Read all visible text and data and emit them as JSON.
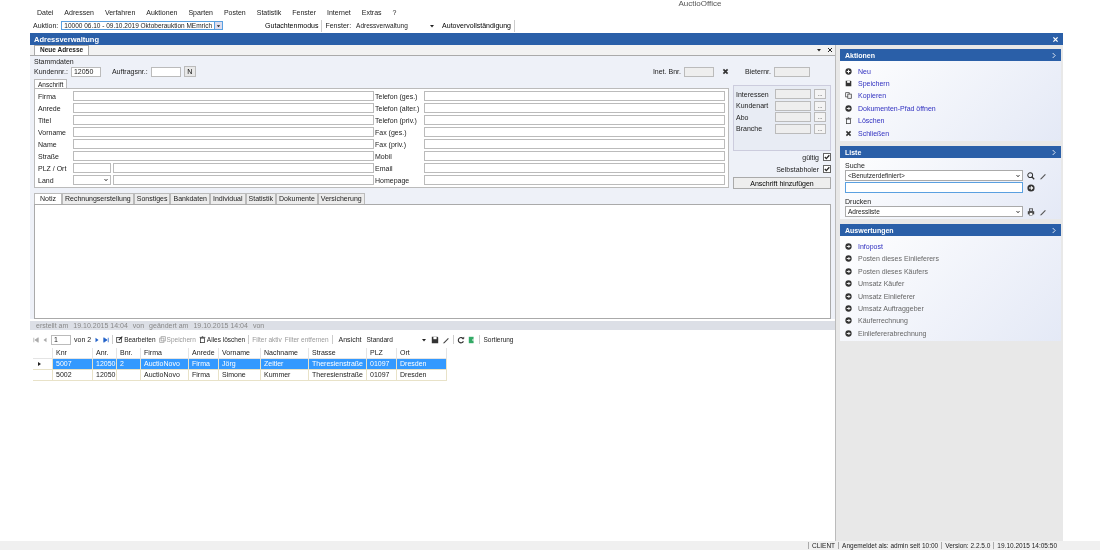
{
  "window": {
    "title": "AuctioOffice"
  },
  "menu": [
    "Datei",
    "Adressen",
    "Verfahren",
    "Auktionen",
    "Sparten",
    "Posten",
    "Statistik",
    "Fenster",
    "Internet",
    "Extras",
    "?"
  ],
  "toolbar": {
    "auction_label": "Auktion:",
    "auction_value": "10000 06.10 - 09.10.2019 Oktoberauktion MEmrich",
    "expert_mode": "Gutachtenmodus",
    "window_label": "Fenster:",
    "window_value": "Adressverwaltung",
    "autocomplete": "Autovervollständigung"
  },
  "panel": {
    "title": "Adressverwaltung"
  },
  "doc_tabs": [
    {
      "label": "Neue Adresse",
      "selected": true
    }
  ],
  "master": {
    "section": "Stammdaten",
    "customer_label": "Kundennr.:",
    "customer_value": "12050",
    "order_label": "Auftragsnr.:",
    "order_button": "N",
    "inet_label": "Inet. Bnr.",
    "bidder_label": "Bieternr."
  },
  "address_tab": "Anschrift",
  "left_fields": [
    {
      "label": "Firma",
      "kind": "text"
    },
    {
      "label": "Anrede",
      "kind": "text"
    },
    {
      "label": "Titel",
      "kind": "text"
    },
    {
      "label": "Vorname",
      "kind": "text"
    },
    {
      "label": "Name",
      "kind": "text"
    },
    {
      "label": "Straße",
      "kind": "text"
    },
    {
      "label": "PLZ / Ort",
      "kind": "split"
    },
    {
      "label": "Land",
      "kind": "select"
    }
  ],
  "right_fields": [
    "Telefon (ges.)",
    "Telefon (alter.)",
    "Telefon (priv.)",
    "Fax (ges.)",
    "Fax (priv.)",
    "Mobil",
    "Email",
    "Homepage"
  ],
  "lookups": [
    {
      "label": "Interessen",
      "button": "..."
    },
    {
      "label": "Kundenart",
      "button": "..."
    },
    {
      "label": "Abo",
      "button": "..."
    },
    {
      "label": "Branche",
      "button": "..."
    }
  ],
  "checks": [
    {
      "label": "gültig",
      "checked": true
    },
    {
      "label": "Selbstabholer",
      "checked": true
    }
  ],
  "add_address_button": "Anschrift hinzufügen",
  "detail_tabs": [
    {
      "label": "Notiz",
      "selected": true
    },
    {
      "label": "Rechnungserstellung",
      "selected": false
    },
    {
      "label": "Sonstiges",
      "selected": false
    },
    {
      "label": "Bankdaten",
      "selected": false
    },
    {
      "label": "Individual",
      "selected": false
    },
    {
      "label": "Statistik",
      "selected": false
    },
    {
      "label": "Dokumente",
      "selected": false
    },
    {
      "label": "Versicherung",
      "selected": false
    }
  ],
  "audit": [
    "erstellt am",
    "19.10.2015 14:04",
    "von",
    "geändert am",
    "19.10.2015 14:04",
    "von"
  ],
  "grid_toolbar": {
    "page": "1",
    "page_of": "von 2",
    "items": [
      {
        "kind": "edit",
        "label": "Bearbeiten",
        "disabled": false
      },
      {
        "kind": "save",
        "label": "Speichern",
        "disabled": true
      },
      {
        "kind": "delete",
        "label": "Alles löschen",
        "disabled": false
      },
      {
        "kind": "filter",
        "label": "Filter aktiv",
        "disabled": true
      },
      {
        "kind": "filter",
        "label": "Filter entfernen",
        "disabled": true
      }
    ],
    "view_label": "Ansicht",
    "view_value": "Standard",
    "sorting": "Sortierung"
  },
  "table": {
    "columns": [
      "Knr",
      "Anr.",
      "Bnr.",
      "Firma",
      "Anrede",
      "Vorname",
      "Nachname",
      "Strasse",
      "PLZ",
      "Ort"
    ],
    "rows": [
      {
        "selected": true,
        "cells": [
          "5007",
          "12050",
          "2",
          "AuctioNovo",
          "Firma",
          "Jörg",
          "Zeitler",
          "Theresienstraße",
          "01097",
          "Dresden"
        ]
      },
      {
        "selected": false,
        "cells": [
          "5002",
          "12050",
          "",
          "AuctioNovo",
          "Firma",
          "Simone",
          "Kummer",
          "Theresienstraße",
          "01097",
          "Dresden"
        ]
      }
    ]
  },
  "actions": {
    "title": "Aktionen",
    "items": [
      {
        "kind": "new",
        "label": "Neu"
      },
      {
        "kind": "save",
        "label": "Speichern"
      },
      {
        "kind": "copy",
        "label": "Kopieren"
      },
      {
        "kind": "open",
        "label": "Dokumenten-Pfad öffnen"
      },
      {
        "kind": "delete",
        "label": "Löschen"
      },
      {
        "kind": "close",
        "label": "Schließen"
      }
    ]
  },
  "list_panel": {
    "title": "Liste",
    "search_label": "Suche",
    "search_value": "<Benutzerdefiniert>",
    "print_label": "Drucken",
    "print_value": "Adressliste"
  },
  "reports": {
    "title": "Auswertungen",
    "items": [
      {
        "label": "Infopost",
        "disabled": false
      },
      {
        "label": "Posten dieses Einlieferers",
        "disabled": true
      },
      {
        "label": "Posten dieses Käufers",
        "disabled": true
      },
      {
        "label": "Umsatz Käufer",
        "disabled": true
      },
      {
        "label": "Umsatz Einlieferer",
        "disabled": true
      },
      {
        "label": "Umsatz Auftraggeber",
        "disabled": true
      },
      {
        "label": "Käuferrechnung",
        "disabled": true
      },
      {
        "label": "Einliefererabrechnung",
        "disabled": true
      }
    ]
  },
  "status_bar": [
    "CLIENT",
    "Angemeldet als: admin seit 10:00",
    "Version: 2.2.5.0",
    "19.10.2015 14:05:50"
  ]
}
